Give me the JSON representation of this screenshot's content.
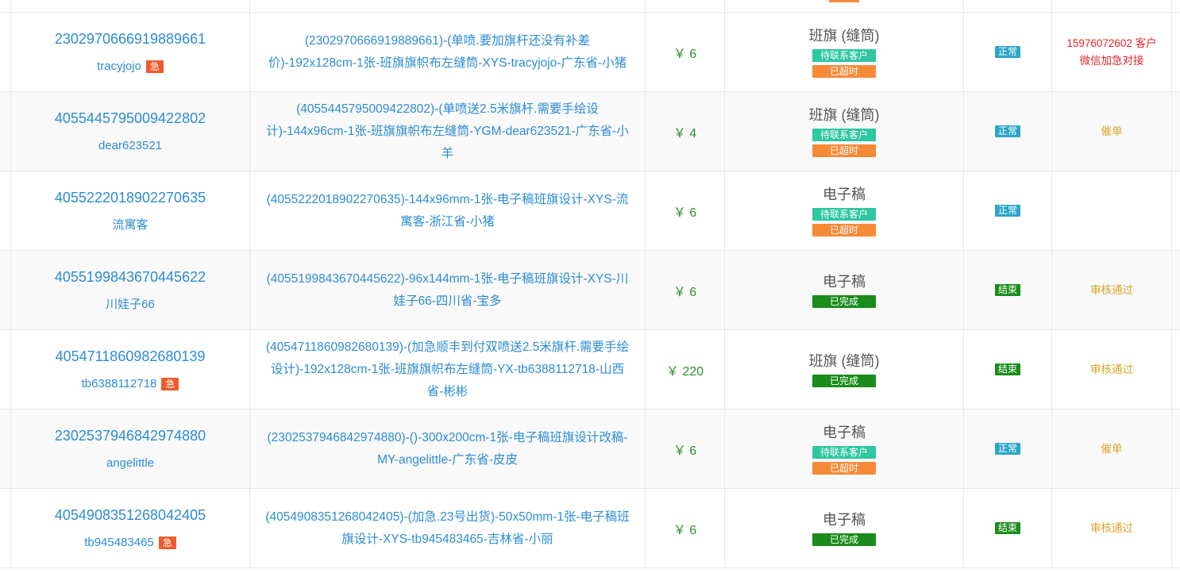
{
  "rows": [
    {
      "order_id": "2302970666919889661",
      "buyer": "tracyjojo",
      "urgent": "急",
      "title": "(2302970666919889661)-(单喷.要加旗杆还没有补差价)-192x128cm-1张-班旗旗帜布左缝筒-XYS-tracyjojo-广东省-小猪",
      "price": "￥ 6",
      "product_type": "班旗 (缝筒)",
      "tags": [
        {
          "label": "待联系客户",
          "kind": "pending"
        },
        {
          "label": "已超时",
          "kind": "overdue"
        }
      ],
      "status": "正常",
      "status_kind": "normal",
      "note_lines": [
        "15976072602 客户",
        "微信加急对接"
      ],
      "note_color": "red"
    },
    {
      "order_id": "4055445795009422802",
      "buyer": "dear623521",
      "urgent": "",
      "title": "(4055445795009422802)-(单喷送2.5米旗杆.需要手绘设计)-144x96cm-1张-班旗旗帜布左缝筒-YGM-dear623521-广东省-小羊",
      "price": "￥ 4",
      "product_type": "班旗 (缝筒)",
      "tags": [
        {
          "label": "待联系客户",
          "kind": "pending"
        },
        {
          "label": "已超时",
          "kind": "overdue"
        }
      ],
      "status": "正常",
      "status_kind": "normal",
      "note_lines": [
        "催单"
      ],
      "note_color": "gold"
    },
    {
      "order_id": "4055222018902270635",
      "buyer": "流寓客",
      "urgent": "",
      "title": "(4055222018902270635)-144x96mm-1张-电子稿班旗设计-XYS-流寓客-浙江省-小猪",
      "price": "￥ 6",
      "product_type": "电子稿",
      "tags": [
        {
          "label": "待联系客户",
          "kind": "pending"
        },
        {
          "label": "已超时",
          "kind": "overdue"
        }
      ],
      "status": "正常",
      "status_kind": "normal",
      "note_lines": [],
      "note_color": "gold"
    },
    {
      "order_id": "4055199843670445622",
      "buyer": "川娃子66",
      "urgent": "",
      "title": "(4055199843670445622)-96x144mm-1张-电子稿班旗设计-XYS-川娃子66-四川省-宝多",
      "price": "￥ 6",
      "product_type": "电子稿",
      "tags": [
        {
          "label": "已完成",
          "kind": "done"
        }
      ],
      "status": "结束",
      "status_kind": "end",
      "note_lines": [
        "审核通过"
      ],
      "note_color": "gold"
    },
    {
      "order_id": "4054711860982680139",
      "buyer": "tb6388112718",
      "urgent": "急",
      "title": "(4054711860982680139)-(加急顺丰到付双喷送2.5米旗杆.需要手绘设计)-192x128cm-1张-班旗旗帜布左缝筒-YX-tb6388112718-山西省-彬彬",
      "price": "￥ 220",
      "product_type": "班旗 (缝筒)",
      "tags": [
        {
          "label": "已完成",
          "kind": "done"
        }
      ],
      "status": "结束",
      "status_kind": "end",
      "note_lines": [
        "审核通过"
      ],
      "note_color": "gold"
    },
    {
      "order_id": "2302537946842974880",
      "buyer": "angelittle",
      "urgent": "",
      "title": "(2302537946842974880)-()-300x200cm-1张-电子稿班旗设计改稿-MY-angelittle-广东省-皮皮",
      "price": "￥ 6",
      "product_type": "电子稿",
      "tags": [
        {
          "label": "待联系客户",
          "kind": "pending"
        },
        {
          "label": "已超时",
          "kind": "overdue"
        }
      ],
      "status": "正常",
      "status_kind": "normal",
      "note_lines": [
        "催单"
      ],
      "note_color": "gold"
    },
    {
      "order_id": "4054908351268042405",
      "buyer": "tb945483465",
      "urgent": "急",
      "title": "(4054908351268042405)-(加急.23号出货)-50x50mm-1张-电子稿班旗设计-XYS-tb945483465-吉林省-小丽",
      "price": "￥ 6",
      "product_type": "电子稿",
      "tags": [
        {
          "label": "已完成",
          "kind": "done"
        }
      ],
      "status": "结束",
      "status_kind": "end",
      "note_lines": [
        "审核通过"
      ],
      "note_color": "gold"
    }
  ],
  "colors": {
    "link": "#2d8cd3",
    "price": "#2e8f2e",
    "urgent": "#ef5b2c",
    "pending": "#2ec79f",
    "overdue": "#f78a36",
    "done": "#1a8c1a",
    "normal": "#2ba6c9",
    "note_red": "#e0282c",
    "note_gold": "#d9a52a"
  }
}
